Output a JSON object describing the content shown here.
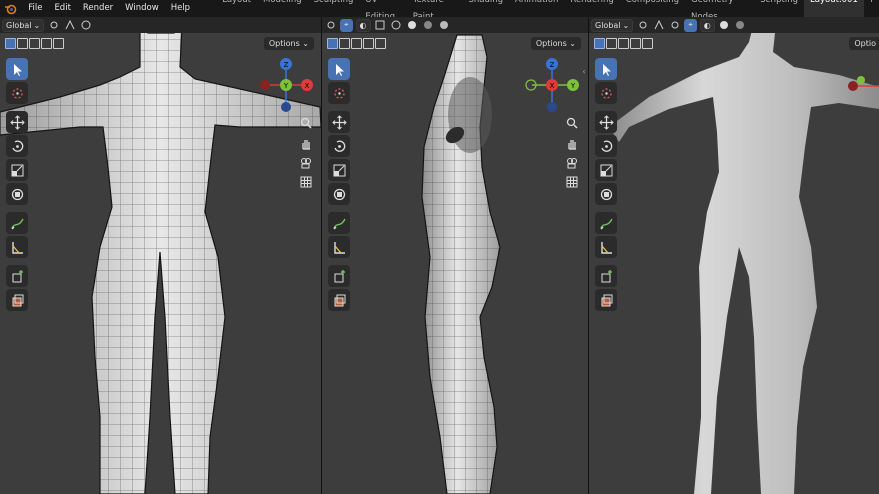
{
  "menu": {
    "file": "File",
    "edit": "Edit",
    "render": "Render",
    "window": "Window",
    "help": "Help"
  },
  "workspaces": [
    "Layout",
    "Modeling",
    "Sculpting",
    "UV Editing",
    "Texture Paint",
    "Shading",
    "Animation",
    "Rendering",
    "Compositing",
    "Geometry Nodes",
    "Scripting",
    "Layout.001"
  ],
  "active_workspace": "Layout.001",
  "viewports": [
    {
      "orientation": "Global",
      "options": "Options",
      "gizmo": {
        "x": "X",
        "y": "Y",
        "z": "Z",
        "view": "front"
      }
    },
    {
      "orientation": "Global",
      "options": "Options",
      "gizmo": {
        "x": "X",
        "y": "Y",
        "z": "Z",
        "view": "side"
      }
    },
    {
      "orientation": "Global",
      "options": "Optio",
      "gizmo": {
        "x": "X",
        "y": "Y",
        "z": "Z",
        "view": "front"
      }
    }
  ],
  "colors": {
    "accent": "#4772b3",
    "x_axis": "#e03a3a",
    "y_axis": "#7bc13a",
    "z_axis": "#3a73d6",
    "viewport_bg": "#3d3d3d"
  },
  "tools": [
    "select-box",
    "cursor",
    "move",
    "rotate",
    "scale",
    "transform",
    "annotate",
    "measure",
    "add-cube",
    "extrude-region"
  ]
}
